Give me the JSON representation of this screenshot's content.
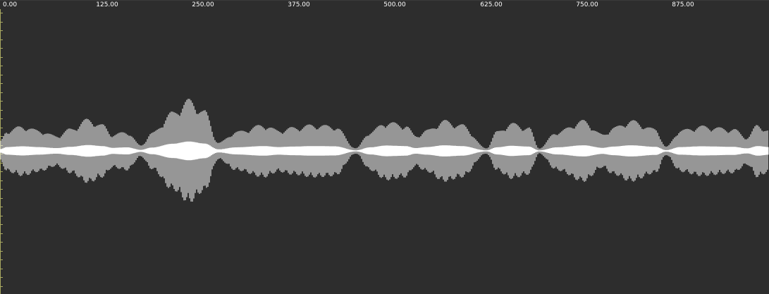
{
  "ruler": {
    "labels": [
      "0.00",
      "125.00",
      "250.00",
      "375.00",
      "500.00",
      "625.00",
      "750.00",
      "875.00"
    ]
  },
  "colors": {
    "background": "#2d2d2d",
    "waveform": "#ffffff",
    "ruler_text": "#ffffff",
    "scale_ticks": "#a8a860"
  },
  "icons": []
}
